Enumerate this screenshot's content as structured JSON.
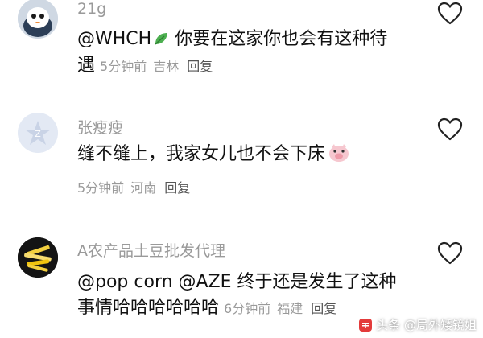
{
  "comments": [
    {
      "username": "21g",
      "line1": "@WHCH",
      "line1_rest": "  你要在这家你也会有这种待",
      "line2": "遇",
      "time": "5分钟前",
      "location": "吉林",
      "reply": "回复",
      "avatar_icon": "bird-avatar-icon",
      "decoration_icon": "leaf-emoji-icon"
    },
    {
      "username": "张瘦瘦",
      "line1": "缝不缝上，我家女儿也不会下床",
      "time": "5分钟前",
      "location": "河南",
      "reply": "回复",
      "avatar_icon": "default-avatar-icon",
      "decoration_icon": "pig-face-emoji-icon"
    },
    {
      "username": "A农产品土豆批发代理",
      "line1": "@pop corn  @AZE  终于还是发生了这种",
      "line2": "事情哈哈哈哈哈哈",
      "time": "6分钟前",
      "location": "福建",
      "reply": "回复",
      "avatar_icon": "fries-avatar-icon"
    }
  ],
  "watermark": {
    "text": "头条 @局外矮镜姐"
  },
  "colors": {
    "meta_gray": "#9a9a9a",
    "text": "#111111",
    "heart": "#222222"
  }
}
